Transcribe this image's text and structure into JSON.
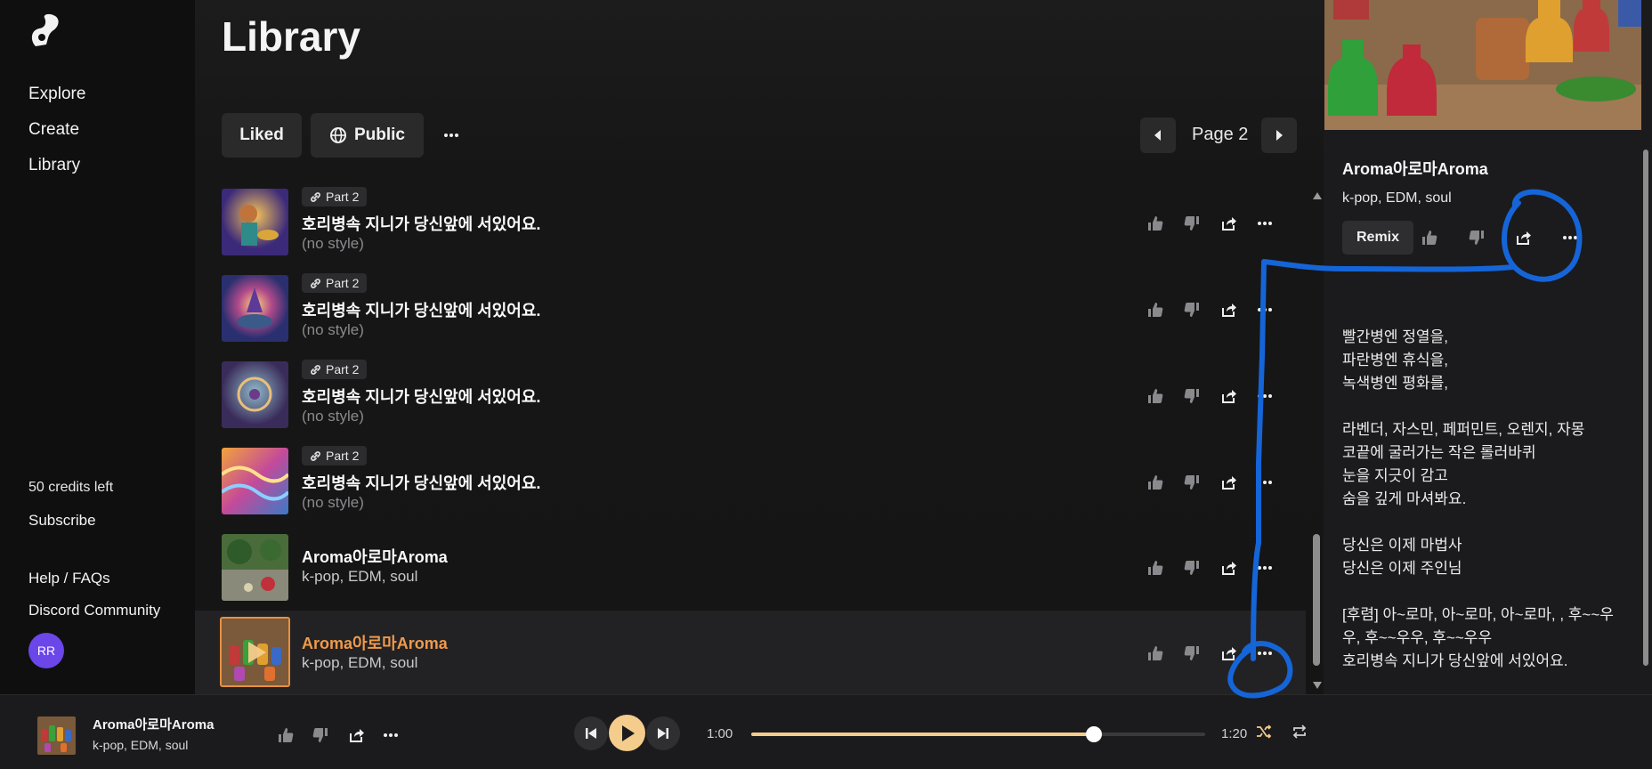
{
  "sidebar": {
    "nav": [
      "Explore",
      "Create",
      "Library"
    ],
    "credits": "50 credits left",
    "subscribe": "Subscribe",
    "help": "Help / FAQs",
    "discord": "Discord Community",
    "avatar_initials": "RR"
  },
  "main": {
    "title": "Library",
    "filter_liked": "Liked",
    "filter_public": "Public",
    "page_label": "Page 2",
    "rows": [
      {
        "tag": "Part 2",
        "title": "호리병속 지니가 당신앞에 서있어요.",
        "subtitle": "(no style)"
      },
      {
        "tag": "Part 2",
        "title": "호리병속 지니가 당신앞에 서있어요.",
        "subtitle": "(no style)"
      },
      {
        "tag": "Part 2",
        "title": "호리병속 지니가 당신앞에 서있어요.",
        "subtitle": "(no style)"
      },
      {
        "tag": "Part 2",
        "title": "호리병속 지니가 당신앞에 서있어요.",
        "subtitle": "(no style)"
      },
      {
        "title": "Aroma아로마Aroma",
        "subtitle": "k-pop, EDM, soul"
      },
      {
        "title": "Aroma아로마Aroma",
        "subtitle": "k-pop, EDM, soul"
      }
    ]
  },
  "detail": {
    "title": "Aroma아로마Aroma",
    "genre": "k-pop, EDM, soul",
    "remix": "Remix",
    "lyrics": "빨간병엔 정열을,\n파란병엔 휴식을,\n녹색병엔 평화를,\n\n라벤더, 자스민, 페퍼민트, 오렌지, 자몽\n코끝에 굴러가는 작은 롤러바퀴\n눈을 지긋이 감고\n숨을 깊게 마셔봐요.\n\n당신은 이제 마법사\n당신은 이제 주인님\n\n[후렴] 아~로마, 아~로마, 아~로마, , 후~~우우, 후~~우우, 후~~우우\n호리병속 지니가 당신앞에 서있어요."
  },
  "player": {
    "title": "Aroma아로마Aroma",
    "genre": "k-pop, EDM, soul",
    "current_time": "1:00",
    "duration": "1:20",
    "progress": 0.755
  },
  "colors": {
    "accent": "#f4cc8c",
    "active_title": "#f09a4b",
    "annotation": "#1565d8",
    "avatar": "#6b46e8"
  }
}
